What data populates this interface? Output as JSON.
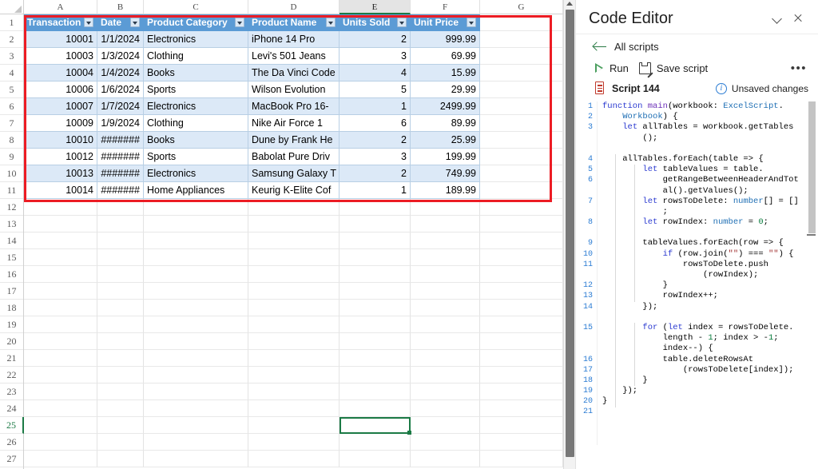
{
  "spreadsheet": {
    "column_headers": [
      "A",
      "B",
      "C",
      "D",
      "E",
      "F",
      "G"
    ],
    "active_column": "E",
    "active_cell": "E25",
    "table_headers": [
      "Transaction ID",
      "Date",
      "Product Category",
      "Product Name",
      "Units Sold",
      "Unit Price"
    ],
    "rows": [
      {
        "n": "2",
        "banded": true,
        "cells": [
          "10001",
          "1/1/2024",
          "Electronics",
          "iPhone 14 Pro",
          "2",
          "999.99"
        ]
      },
      {
        "n": "3",
        "banded": false,
        "cells": [
          "10003",
          "1/3/2024",
          "Clothing",
          "Levi's 501 Jeans",
          "3",
          "69.99"
        ]
      },
      {
        "n": "4",
        "banded": true,
        "cells": [
          "10004",
          "1/4/2024",
          "Books",
          "The Da Vinci Code",
          "4",
          "15.99"
        ]
      },
      {
        "n": "5",
        "banded": false,
        "cells": [
          "10006",
          "1/6/2024",
          "Sports",
          "Wilson Evolution",
          "5",
          "29.99"
        ]
      },
      {
        "n": "6",
        "banded": true,
        "cells": [
          "10007",
          "1/7/2024",
          "Electronics",
          "MacBook Pro 16-",
          "1",
          "2499.99"
        ]
      },
      {
        "n": "7",
        "banded": false,
        "cells": [
          "10009",
          "1/9/2024",
          "Clothing",
          "Nike Air Force 1",
          "6",
          "89.99"
        ]
      },
      {
        "n": "8",
        "banded": true,
        "cells": [
          "10010",
          "#######",
          "Books",
          "Dune by Frank He",
          "2",
          "25.99"
        ]
      },
      {
        "n": "9",
        "banded": false,
        "cells": [
          "10012",
          "#######",
          "Sports",
          "Babolat Pure Driv",
          "3",
          "199.99"
        ]
      },
      {
        "n": "10",
        "banded": true,
        "cells": [
          "10013",
          "#######",
          "Electronics",
          "Samsung Galaxy T",
          "2",
          "749.99"
        ]
      },
      {
        "n": "11",
        "banded": false,
        "cells": [
          "10014",
          "#######",
          "Home Appliances",
          "Keurig K-Elite Cof",
          "1",
          "189.99"
        ]
      }
    ],
    "empty_row_numbers": [
      "12",
      "13",
      "14",
      "15",
      "16",
      "17",
      "18",
      "19",
      "20",
      "21",
      "22",
      "23",
      "24",
      "25",
      "26",
      "27"
    ],
    "header_color": "#5b9bd5",
    "band_color": "#dce9f7",
    "selection_color": "#1b7a45",
    "annotation_color": "#ec1c24"
  },
  "editor": {
    "title": "Code Editor",
    "collapse_icon": "chevron-down-icon",
    "close_icon": "close-icon",
    "back_label": "All scripts",
    "run_label": "Run",
    "save_label": "Save script",
    "more_label": "•••",
    "script_name": "Script 144",
    "status_label": "Unsaved changes",
    "line_numbers": [
      "1",
      "2",
      "3",
      "4",
      "5",
      "6",
      "7",
      "8",
      "9",
      "10",
      "11",
      "12",
      "13",
      "14",
      "15",
      "16",
      "17",
      "18",
      "19",
      "20",
      "21"
    ],
    "code": [
      "function main(workbook: ExcelScript.",
      "    Workbook) {",
      "    let allTables = workbook.getTables",
      "        ();",
      "",
      "    allTables.forEach(table => {",
      "        let tableValues = table.",
      "            getRangeBetweenHeaderAndTot",
      "            al().getValues();",
      "        let rowsToDelete: number[] = []",
      "            ;",
      "        let rowIndex: number = 0;",
      "",
      "        tableValues.forEach(row => {",
      "            if (row.join(\"\") === \"\") {",
      "                rowsToDelete.push",
      "                    (rowIndex);",
      "            }",
      "            rowIndex++;",
      "        });",
      "",
      "        for (let index = rowsToDelete.",
      "            length - 1; index > -1;",
      "            index--) {",
      "            table.deleteRowsAt",
      "                (rowsToDelete[index]);",
      "        }",
      "    });",
      "}",
      ""
    ]
  }
}
